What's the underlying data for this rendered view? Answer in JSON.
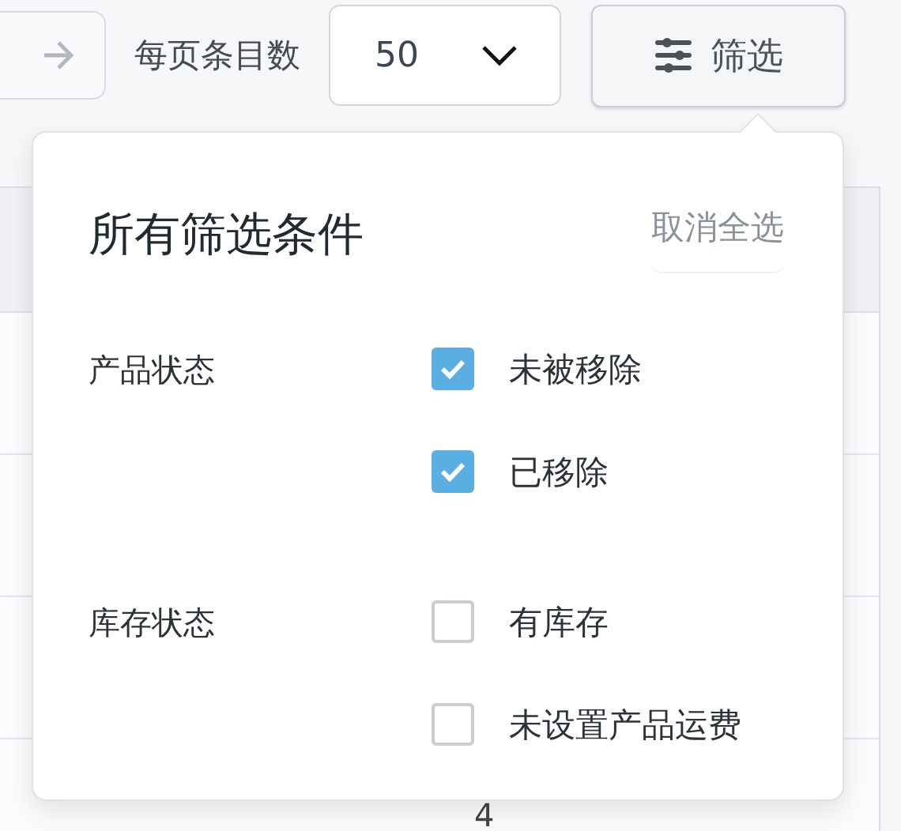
{
  "toolbar": {
    "per_page_label": "每页条目数",
    "per_page_value": "50",
    "filter_button": "筛选"
  },
  "table": {
    "visible_cell": "4"
  },
  "filter_panel": {
    "title": "所有筛选条件",
    "clear_button": "取消全选",
    "groups": [
      {
        "label": "产品状态",
        "options": [
          {
            "label": "未被移除",
            "checked": true
          },
          {
            "label": "已移除",
            "checked": true
          }
        ]
      },
      {
        "label": "库存状态",
        "options": [
          {
            "label": "有库存",
            "checked": false
          },
          {
            "label": "未设置产品运费",
            "checked": false
          }
        ]
      }
    ]
  }
}
